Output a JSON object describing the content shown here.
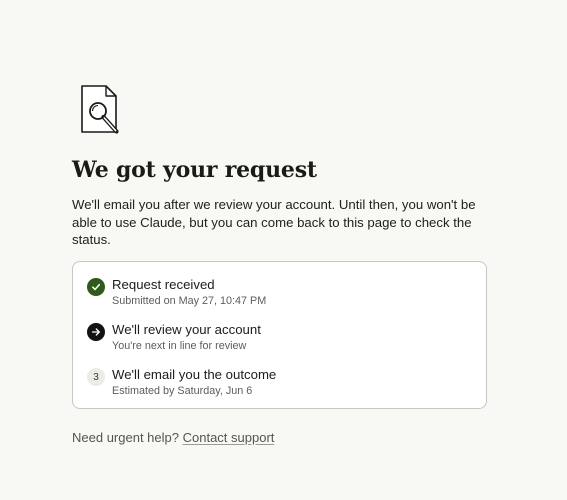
{
  "page": {
    "icon": "document-search-icon",
    "title": "We got your request",
    "description": "We'll email you after we review your account. Until then, you won't be able to use Claude, but you can come back to this page to check the status."
  },
  "steps": [
    {
      "status": "done",
      "icon": "checkmark-icon",
      "title": "Request received",
      "subtitle": "Submitted on May 27, 10:47 PM"
    },
    {
      "status": "current",
      "icon": "arrow-right-icon",
      "title": "We'll review your account",
      "subtitle": "You're next in line for review"
    },
    {
      "status": "upcoming",
      "number": "3",
      "title": "We'll email you the outcome",
      "subtitle": "Estimated by Saturday, Jun 6"
    }
  ],
  "help": {
    "prefix": "Need urgent help?",
    "link_label": "Contact support"
  },
  "colors": {
    "background": "#f8f8f5",
    "done": "#2f5a1c",
    "current": "#121212",
    "upcoming": "#ecebe6"
  }
}
